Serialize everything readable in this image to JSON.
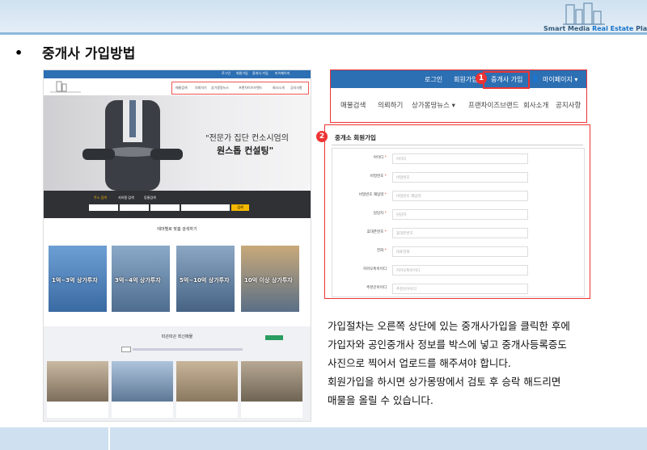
{
  "brand": {
    "name_part1": "Smart Media ",
    "name_part2": "Real Estate",
    "name_part3": " Platform"
  },
  "slide": {
    "bullet": "•",
    "title": "중개사 가입방법"
  },
  "site": {
    "topnav": [
      "로그인",
      "회원가입",
      "중개사 가입",
      "마이페이지"
    ],
    "menu": [
      "매물검색",
      "의뢰하기",
      "상가몽땅뉴스",
      "프랜차이즈브랜드",
      "회사소개",
      "공지사항"
    ],
    "hero_line1": "\"전문가 집단 컨소시엄의",
    "hero_line2": "원스톱 컨설팅\"",
    "search_tabs": [
      "주소 검색",
      "지하철 검색",
      "동물검색"
    ],
    "search_btn": "검색",
    "theme_title": "테마별로 맞춤 검색하기",
    "thumbs": [
      "1억~3억 상가투자",
      "3억~4억 상가투자",
      "5억~10억 상가투자",
      "10억 이상 상가투자"
    ],
    "listing_title": "따끈따끈 최신매물"
  },
  "zoom1": {
    "topnav": [
      "로그인",
      "회원가입",
      "중개사 가입",
      "마이페이지 ▾"
    ],
    "menu": [
      "매물검색",
      "의뢰하기",
      "상가몽땅뉴스 ▾",
      "프랜차이즈브랜드",
      "회사소개",
      "공지사항"
    ]
  },
  "badges": [
    "1",
    "2"
  ],
  "form": {
    "title": "중개소 회원가입",
    "rows": [
      {
        "label": "아이디",
        "req": "*",
        "placeholder": "아이디"
      },
      {
        "label": "비밀번호",
        "req": "*",
        "placeholder": "비밀번호"
      },
      {
        "label": "비밀번호 재입력",
        "req": "*",
        "placeholder": "비밀번호 재입력"
      },
      {
        "label": "담당자",
        "req": "*",
        "placeholder": "담당자"
      },
      {
        "label": "휴대폰번호",
        "req": "*",
        "placeholder": "휴대폰번호"
      },
      {
        "label": "전화",
        "req": "*",
        "placeholder": "대표전화"
      },
      {
        "label": "카카오톡아이디",
        "req": "",
        "placeholder": "카카오톡아이디"
      },
      {
        "label": "추천인아이디",
        "req": "",
        "placeholder": "추천인아이디"
      }
    ]
  },
  "description": [
    "가입절차는 오른쪽 상단에 있는 중개사가입을 클릭한 후에",
    "가입자와 공인중개사 정보를 박스에 넣고 중개사등록증도",
    "사진으로 찍어서 업로드를 해주셔야 합니다.",
    "회원가입을 하시면 상가몽땅에서 검토 후 승락 해드리면",
    "매물을 올릴 수 있습니다."
  ]
}
